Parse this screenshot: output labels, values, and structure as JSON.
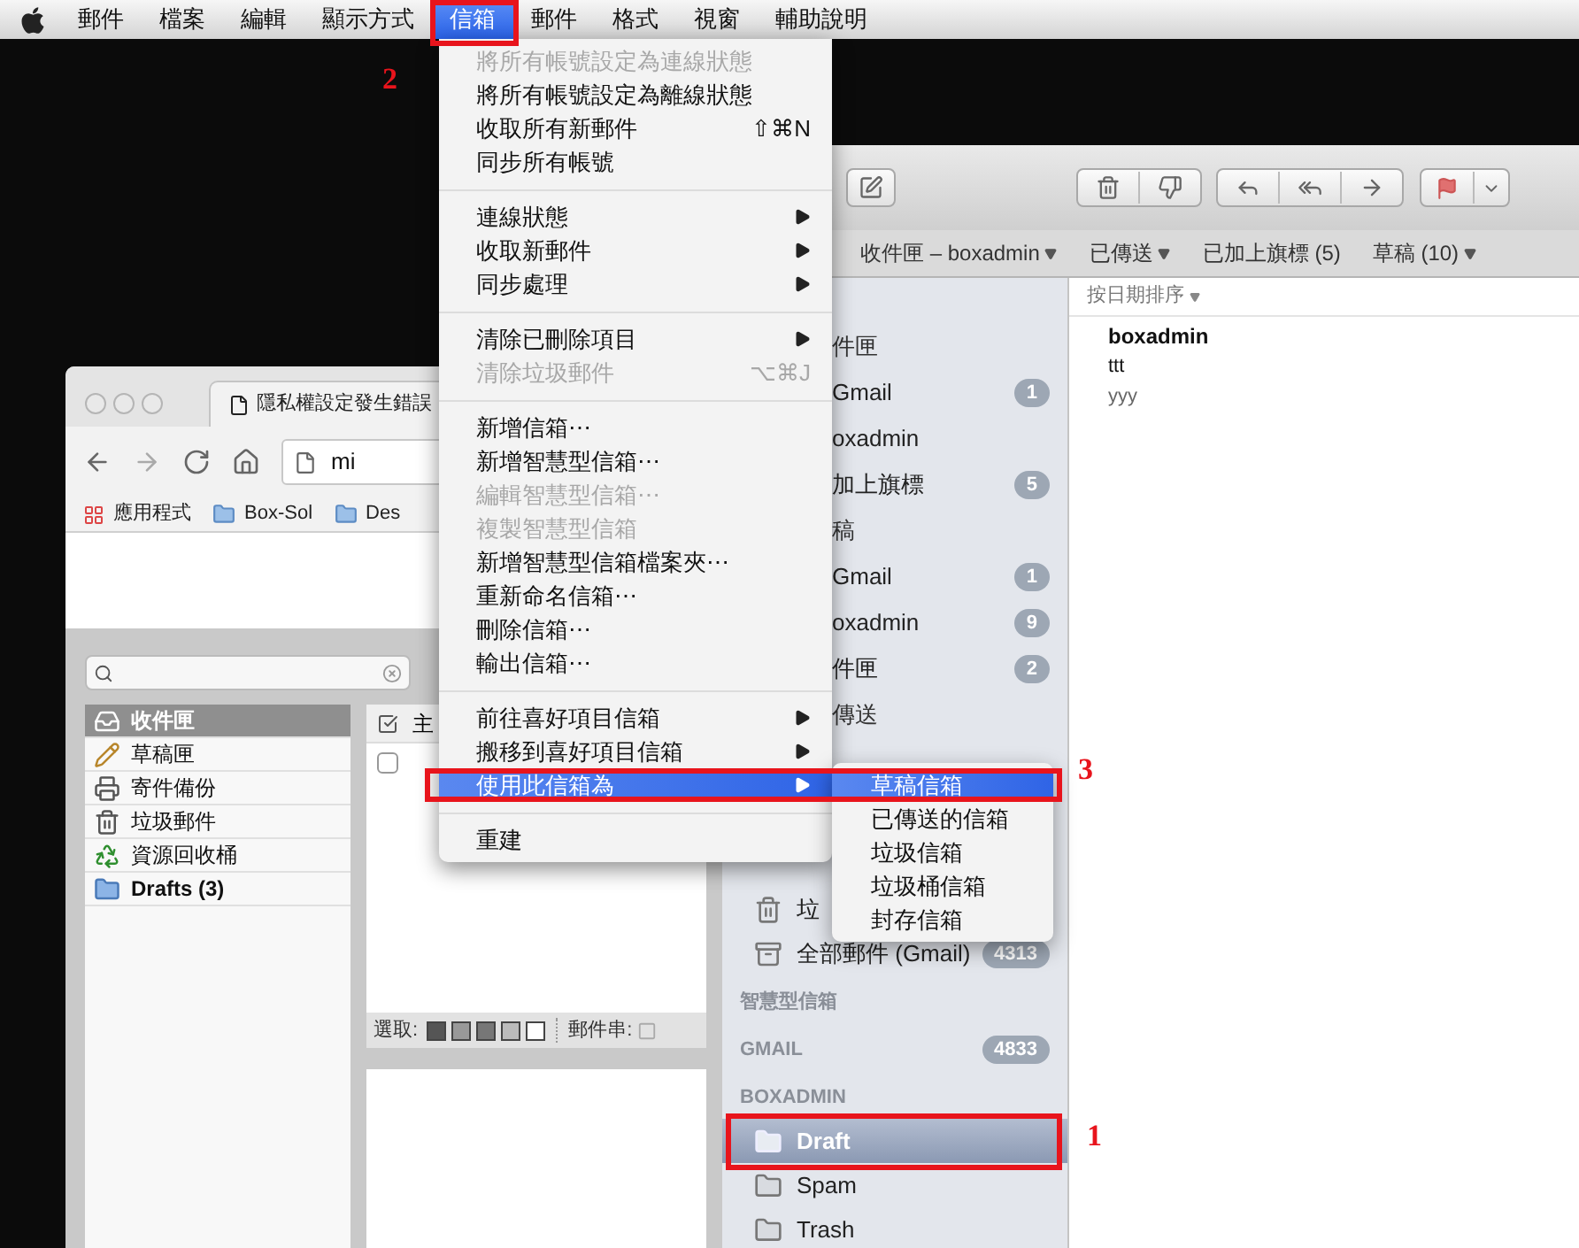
{
  "menubar": {
    "items": [
      {
        "label": "郵件",
        "selected": false
      },
      {
        "label": "檔案",
        "selected": false
      },
      {
        "label": "編輯",
        "selected": false
      },
      {
        "label": "顯示方式",
        "selected": false
      },
      {
        "label": "信箱",
        "selected": true
      },
      {
        "label": "郵件",
        "selected": false
      },
      {
        "label": "格式",
        "selected": false
      },
      {
        "label": "視窗",
        "selected": false
      },
      {
        "label": "輔助說明",
        "selected": false
      }
    ]
  },
  "browser": {
    "tab_title": "隱私權設定發生錯誤",
    "address": "mi",
    "bookmarks": [
      {
        "label": "應用程式",
        "kind": "apps"
      },
      {
        "label": "Box-Sol",
        "kind": "folder"
      },
      {
        "label": "Des",
        "kind": "folder"
      }
    ],
    "webmail": {
      "folders": [
        {
          "label": "收件匣",
          "kind": "inbox",
          "selected": true,
          "unread": false
        },
        {
          "label": "草稿匣",
          "kind": "drafts",
          "selected": false,
          "unread": false
        },
        {
          "label": "寄件備份",
          "kind": "sent",
          "selected": false,
          "unread": false
        },
        {
          "label": "垃圾郵件",
          "kind": "junk",
          "selected": false,
          "unread": false
        },
        {
          "label": "資源回收桶",
          "kind": "trash",
          "selected": false,
          "unread": false
        },
        {
          "label": "Drafts (3)",
          "kind": "folder",
          "selected": false,
          "unread": true
        }
      ],
      "column_header": "主",
      "rows": [
        {
          "checked": false
        }
      ],
      "select_label": "選取:",
      "thread_label": "郵件串:"
    }
  },
  "mail": {
    "favorites": [
      {
        "label": "收件匣 – boxadmin",
        "dropdown": true
      },
      {
        "label": "已傳送",
        "dropdown": true
      },
      {
        "label": "已加上旗標 (5)",
        "dropdown": false
      },
      {
        "label": "草稿 (10)",
        "dropdown": true
      }
    ],
    "sidebar": {
      "upper": [
        {
          "label": "件匣",
          "kind": "header"
        },
        {
          "label": "Gmail",
          "kind": "mailbox",
          "badge": "1"
        },
        {
          "label": "oxadmin",
          "kind": "mailbox"
        },
        {
          "label": "加上旗標",
          "kind": "mailbox",
          "badge": "5"
        },
        {
          "label": "稿",
          "kind": "header"
        },
        {
          "label": "Gmail",
          "kind": "mailbox",
          "badge": "1"
        },
        {
          "label": "oxadmin",
          "kind": "mailbox",
          "badge": "9"
        },
        {
          "label": "件匣",
          "kind": "mailbox",
          "badge": "2"
        },
        {
          "label": "傳送",
          "kind": "header"
        }
      ],
      "lower": [
        {
          "label": "垃",
          "kind": "trash",
          "selected": false
        },
        {
          "label": "全部郵件 (Gmail)",
          "kind": "archive",
          "badge": "4313",
          "selected": false
        },
        {
          "label": "智慧型信箱",
          "kind": "section",
          "selected": false
        },
        {
          "label": "GMAIL",
          "kind": "section",
          "badge": "4833",
          "selected": false
        },
        {
          "label": "BOXADMIN",
          "kind": "section",
          "selected": false
        },
        {
          "label": "Draft",
          "kind": "folder",
          "selected": true
        },
        {
          "label": "Spam",
          "kind": "folder",
          "selected": false
        },
        {
          "label": "Trash",
          "kind": "folder",
          "selected": false
        }
      ]
    },
    "sort_label": "按日期排序",
    "messages": [
      {
        "sender": "boxadmin",
        "subject": "ttt",
        "preview": "yyy"
      }
    ]
  },
  "menu": {
    "items": [
      {
        "kind": "item",
        "label": "將所有帳號設定為連線狀態",
        "disabled": true,
        "submenu": false,
        "selected": false
      },
      {
        "kind": "item",
        "label": "將所有帳號設定為離線狀態",
        "disabled": false,
        "submenu": false,
        "selected": false
      },
      {
        "kind": "item",
        "label": "收取所有新郵件",
        "shortcut": "⇧⌘N",
        "disabled": false,
        "submenu": false,
        "selected": false
      },
      {
        "kind": "item",
        "label": "同步所有帳號",
        "disabled": false,
        "submenu": false,
        "selected": false
      },
      {
        "kind": "separator"
      },
      {
        "kind": "item",
        "label": "連線狀態",
        "disabled": false,
        "submenu": true,
        "selected": false
      },
      {
        "kind": "item",
        "label": "收取新郵件",
        "disabled": false,
        "submenu": true,
        "selected": false
      },
      {
        "kind": "item",
        "label": "同步處理",
        "disabled": false,
        "submenu": true,
        "selected": false
      },
      {
        "kind": "separator"
      },
      {
        "kind": "item",
        "label": "清除已刪除項目",
        "disabled": false,
        "submenu": true,
        "selected": false
      },
      {
        "kind": "item",
        "label": "清除垃圾郵件",
        "shortcut": "⌥⌘J",
        "disabled": true,
        "submenu": false,
        "selected": false
      },
      {
        "kind": "separator"
      },
      {
        "kind": "item",
        "label": "新增信箱⋯",
        "disabled": false,
        "submenu": false,
        "selected": false
      },
      {
        "kind": "item",
        "label": "新增智慧型信箱⋯",
        "disabled": false,
        "submenu": false,
        "selected": false
      },
      {
        "kind": "item",
        "label": "編輯智慧型信箱⋯",
        "disabled": true,
        "submenu": false,
        "selected": false
      },
      {
        "kind": "item",
        "label": "複製智慧型信箱",
        "disabled": true,
        "submenu": false,
        "selected": false
      },
      {
        "kind": "item",
        "label": "新增智慧型信箱檔案夾⋯",
        "disabled": false,
        "submenu": false,
        "selected": false
      },
      {
        "kind": "item",
        "label": "重新命名信箱⋯",
        "disabled": false,
        "submenu": false,
        "selected": false
      },
      {
        "kind": "item",
        "label": "刪除信箱⋯",
        "disabled": false,
        "submenu": false,
        "selected": false
      },
      {
        "kind": "item",
        "label": "輸出信箱⋯",
        "disabled": false,
        "submenu": false,
        "selected": false
      },
      {
        "kind": "separator"
      },
      {
        "kind": "item",
        "label": "前往喜好項目信箱",
        "disabled": false,
        "submenu": true,
        "selected": false
      },
      {
        "kind": "item",
        "label": "搬移到喜好項目信箱",
        "disabled": false,
        "submenu": true,
        "selected": false
      },
      {
        "kind": "item",
        "label": "使用此信箱為",
        "disabled": false,
        "submenu": true,
        "selected": true
      },
      {
        "kind": "separator"
      },
      {
        "kind": "item",
        "label": "重建",
        "disabled": false,
        "submenu": false,
        "selected": false
      }
    ],
    "submenu": [
      {
        "label": "草稿信箱",
        "selected": true
      },
      {
        "label": "已傳送的信箱",
        "selected": false
      },
      {
        "label": "垃圾信箱",
        "selected": false
      },
      {
        "label": "垃圾桶信箱",
        "selected": false
      },
      {
        "label": "封存信箱",
        "selected": false
      }
    ]
  },
  "annotations": [
    {
      "label": "2"
    },
    {
      "label": "3"
    },
    {
      "label": "1"
    }
  ]
}
